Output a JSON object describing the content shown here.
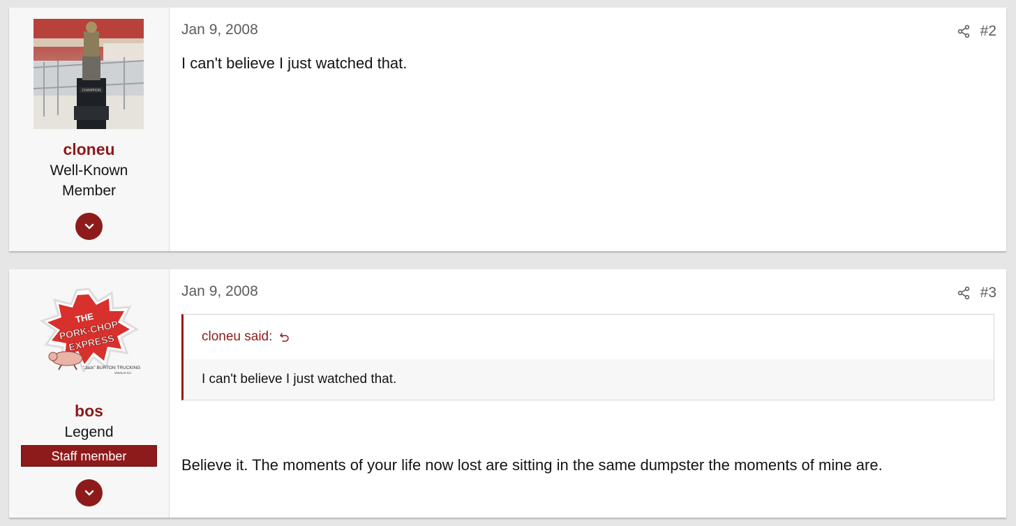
{
  "posts": [
    {
      "user": {
        "name": "cloneu",
        "title_line1": "Well-Known",
        "title_line2": "Member",
        "avatar": "trophy-photo"
      },
      "date": "Jan 9, 2008",
      "number": "#2",
      "body": "I can't believe I just watched that."
    },
    {
      "user": {
        "name": "bos",
        "title": "Legend",
        "staff_badge": "Staff member",
        "avatar": "pork-chop-express-logo",
        "avatar_text_1": "THE",
        "avatar_text_2": "PORK-CHOP",
        "avatar_text_3": "EXPRESS",
        "avatar_text_4": "\"Jack\" BURTON TRUCKING",
        "avatar_text_5": "VISALIA CA"
      },
      "date": "Jan 9, 2008",
      "number": "#3",
      "quote": {
        "author_label": "cloneu said:",
        "text": "I can't believe I just watched that."
      },
      "body": "Believe it. The moments of your life now lost are sitting in the same dumpster the moments of mine are."
    }
  ],
  "colors": {
    "accent": "#8e1b1b",
    "username": "#8d1a1a",
    "page_bg": "#e6e6e6",
    "user_cell_bg": "#f7f7f7"
  },
  "icons": {
    "share": "share-icon",
    "expand": "chevron-down-icon",
    "quote_jump": "jump-to-quote-icon"
  }
}
